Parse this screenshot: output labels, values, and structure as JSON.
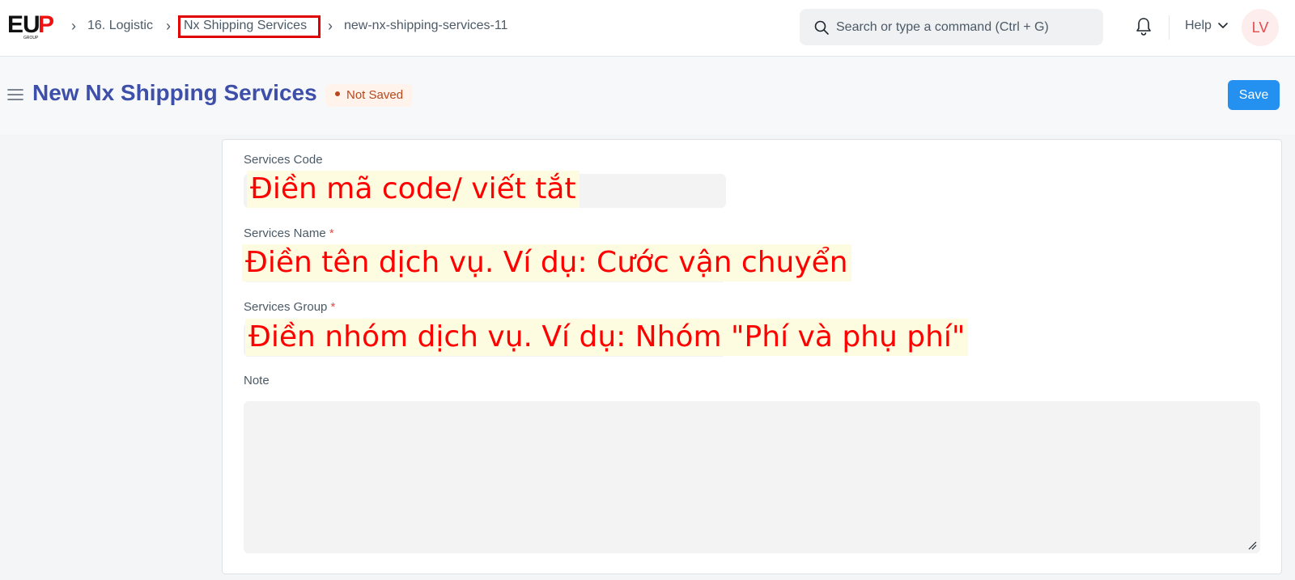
{
  "navbar": {
    "logo_text": "EUP",
    "logo_subtext": "GROUP",
    "breadcrumbs": [
      "16. Logistic",
      "Nx Shipping Services",
      "new-nx-shipping-services-11"
    ],
    "search_placeholder": "Search or type a command (Ctrl + G)",
    "help_label": "Help",
    "avatar_initials": "LV",
    "highlight_color": "#e00000"
  },
  "page": {
    "title": "New Nx Shipping Services",
    "status": "Not Saved",
    "save_label": "Save",
    "accent_color": "#2490ef"
  },
  "form": {
    "fields": [
      {
        "label": "Services Code",
        "required": "",
        "annotation": "Điền mã code/ viết tắt"
      },
      {
        "label": "Services Name",
        "required": "*",
        "annotation": "Điền tên dịch vụ. Ví dụ: Cước vận chuyển"
      },
      {
        "label": "Services Group",
        "required": "*",
        "annotation": "Điền nhóm dịch vụ. Ví dụ: Nhóm \"Phí và phụ phí\""
      },
      {
        "label": "Note",
        "required": ""
      }
    ]
  }
}
